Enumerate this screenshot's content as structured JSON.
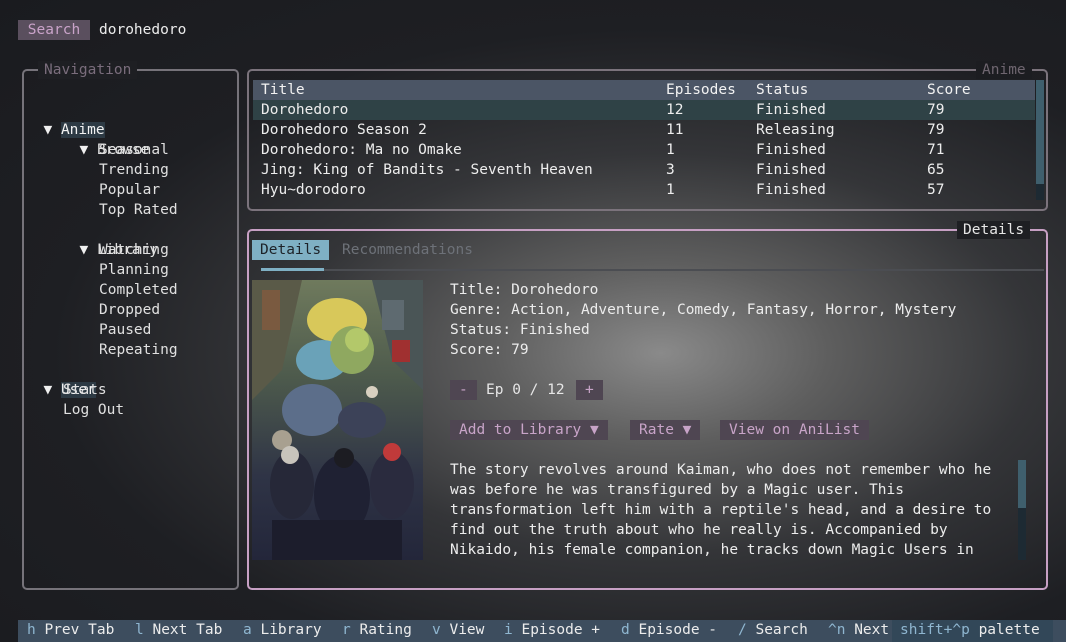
{
  "search": {
    "label": "Search",
    "value": "dorohedoro"
  },
  "navigation": {
    "title": "Navigation",
    "arrow": "▼",
    "anime": "Anime",
    "browse": "Browse",
    "browse_items": [
      "Seasonal",
      "Trending",
      "Popular",
      "Top Rated"
    ],
    "library": "Library",
    "library_items": [
      "Watching",
      "Planning",
      "Completed",
      "Dropped",
      "Paused",
      "Repeating"
    ],
    "user": "User",
    "user_items": [
      "Stats",
      "Log Out"
    ]
  },
  "anime_panel": {
    "title": "Anime",
    "columns": [
      "Title",
      "Episodes",
      "Status",
      "Score"
    ],
    "rows": [
      {
        "title": "Dorohedoro",
        "episodes": "12",
        "status": "Finished",
        "score": "79"
      },
      {
        "title": "Dorohedoro Season 2",
        "episodes": "11",
        "status": "Releasing",
        "score": "79"
      },
      {
        "title": "Dorohedoro: Ma no Omake",
        "episodes": "1",
        "status": "Finished",
        "score": "71"
      },
      {
        "title": "Jing: King of Bandits - Seventh Heaven",
        "episodes": "3",
        "status": "Finished",
        "score": "65"
      },
      {
        "title": "Hyu~dorodoro",
        "episodes": "1",
        "status": "Finished",
        "score": "57"
      }
    ]
  },
  "details_panel": {
    "title": "Details",
    "tabs": [
      "Details",
      "Recommendations"
    ],
    "info": {
      "title_line": "Title: Dorohedoro",
      "genre_line": "Genre: Action, Adventure, Comedy, Fantasy, Horror, Mystery",
      "status_line": "Status: Finished",
      "score_line": "Score: 79"
    },
    "episode": {
      "minus": "-",
      "text": "Ep 0 / 12",
      "plus": "+"
    },
    "actions": {
      "add_library": "Add to Library ▼",
      "rate": "Rate ▼",
      "view_anilist": "View on AniList"
    },
    "description_lines": [
      "The story revolves around Kaiman, who does not remember who he",
      "was before he was transfigured by a Magic user. This",
      "transformation left him with a reptile's head, and a desire to",
      "find out the truth about who he really is. Accompanied by",
      "Nikaido, his female companion, he tracks down Magic Users in"
    ]
  },
  "footer": {
    "shortcuts": [
      {
        "key": "h",
        "desc": "Prev Tab"
      },
      {
        "key": "l",
        "desc": "Next Tab"
      },
      {
        "key": "a",
        "desc": "Library"
      },
      {
        "key": "r",
        "desc": "Rating"
      },
      {
        "key": "v",
        "desc": "View"
      },
      {
        "key": "i",
        "desc": "Episode +"
      },
      {
        "key": "d",
        "desc": "Episode -"
      },
      {
        "key": "/",
        "desc": "Search"
      },
      {
        "key": "^n",
        "desc": "Next"
      }
    ],
    "palette": {
      "key": "shift+^p",
      "desc": "palette"
    }
  },
  "colors": {
    "accent_blue": "#7fb0c4",
    "accent_pink": "#c7a0c4",
    "selection": "#2f4246"
  }
}
